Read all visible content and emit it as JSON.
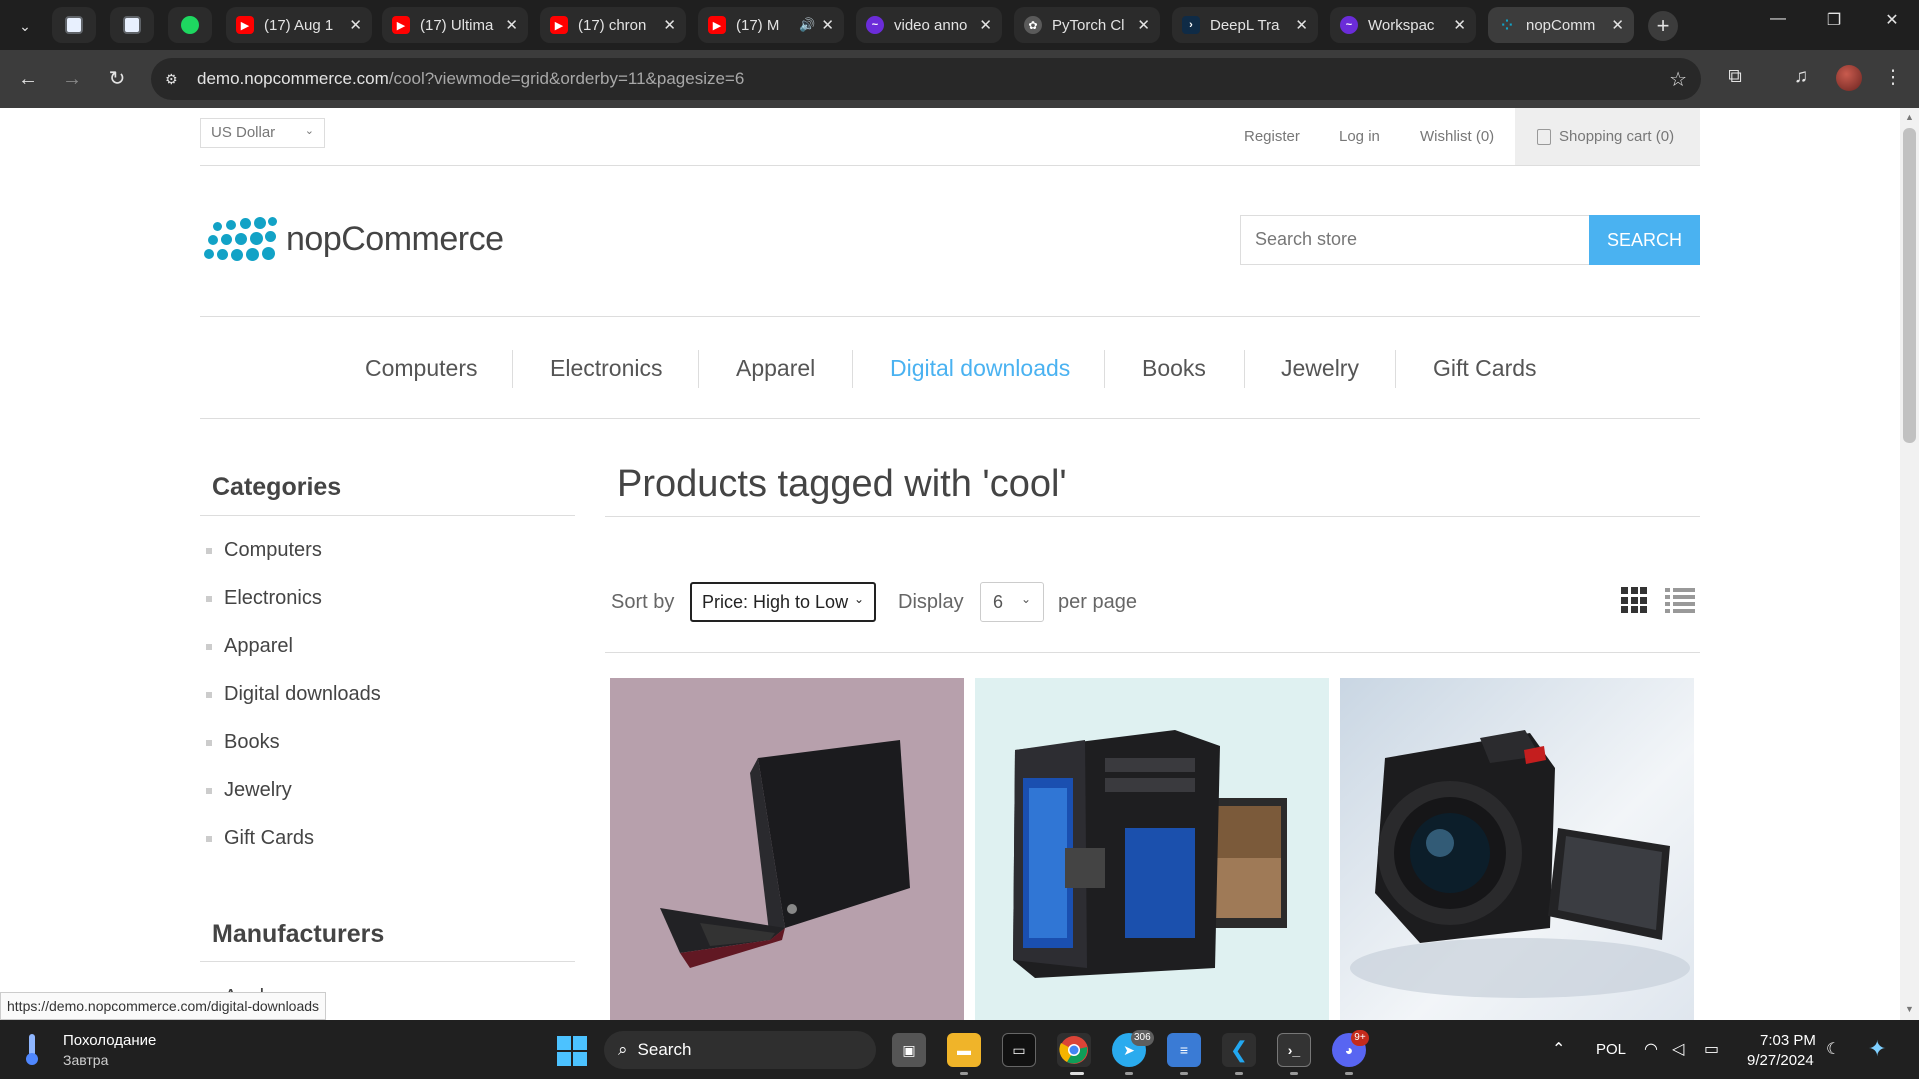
{
  "browser": {
    "tabs": [
      {
        "title": "",
        "favicon": "blue-square-icon",
        "color": "#e8f0fe",
        "pinned": true
      },
      {
        "title": "",
        "favicon": "blue-square-icon",
        "color": "#e8f0fe",
        "pinned": true
      },
      {
        "title": "",
        "favicon": "spotify-icon",
        "color": "#1ed760",
        "pinned": true
      },
      {
        "title": "(17) Aug 1",
        "favicon": "youtube-icon",
        "color": "#ff0000"
      },
      {
        "title": "(17) Ultima",
        "favicon": "youtube-icon",
        "color": "#ff0000"
      },
      {
        "title": "(17) chron",
        "favicon": "youtube-icon",
        "color": "#ff0000"
      },
      {
        "title": "(17) M",
        "favicon": "youtube-icon",
        "color": "#ff0000",
        "audio": true
      },
      {
        "title": "video anno",
        "favicon": "purple-swirl-icon",
        "color": "#6b2cd9"
      },
      {
        "title": "PyTorch Cl",
        "favicon": "openai-icon",
        "color": "#5a5a5a"
      },
      {
        "title": "DeepL Tra",
        "favicon": "deepl-icon",
        "color": "#0f2b46"
      },
      {
        "title": "Workspac",
        "favicon": "purple-swirl-icon",
        "color": "#6b2cd9"
      },
      {
        "title": "nopComm",
        "favicon": "nopcommerce-icon",
        "color": "#12a2c6",
        "active": true
      }
    ],
    "url_host": "demo.nopcommerce.com",
    "url_path": "/cool?viewmode=grid&orderby=11&pagesize=6",
    "status_url": "https://demo.nopcommerce.com/digital-downloads"
  },
  "header": {
    "currency": "US Dollar",
    "register": "Register",
    "login": "Log in",
    "wishlist": "Wishlist (0)",
    "cart": "Shopping cart (0)"
  },
  "logo_text": "nopCommerce",
  "search": {
    "placeholder": "Search store",
    "button": "Search"
  },
  "menu": [
    "Computers",
    "Electronics",
    "Apparel",
    "Digital downloads",
    "Books",
    "Jewelry",
    "Gift Cards"
  ],
  "menu_active": "Digital downloads",
  "sidebar": {
    "categories_title": "Categories",
    "categories": [
      "Computers",
      "Electronics",
      "Apparel",
      "Digital downloads",
      "Books",
      "Jewelry",
      "Gift Cards"
    ],
    "manufacturers_title": "Manufacturers",
    "manufacturers_first_partial": "Apple"
  },
  "main": {
    "title": "Products tagged with 'cool'",
    "sort_label": "Sort by",
    "sort_value": "Price: High to Low",
    "display_label": "Display",
    "display_value": "6",
    "per_page_label": "per page"
  },
  "products": [
    {
      "image": "laptop",
      "bg": "#b7a0ac"
    },
    {
      "image": "desktop-pc",
      "bg": "#dff1f1"
    },
    {
      "image": "dslr-camera",
      "bg": "#e7edf3"
    }
  ],
  "taskbar": {
    "weather_title": "Похолодание",
    "weather_sub": "Завтра",
    "search": "Search",
    "telegram_badge": "306",
    "discord_badge": "9+",
    "language": "POL",
    "time": "7:03 PM",
    "date": "9/27/2024"
  },
  "colors": {
    "accent": "#4ab2f1",
    "brand": "#12a2c6"
  }
}
